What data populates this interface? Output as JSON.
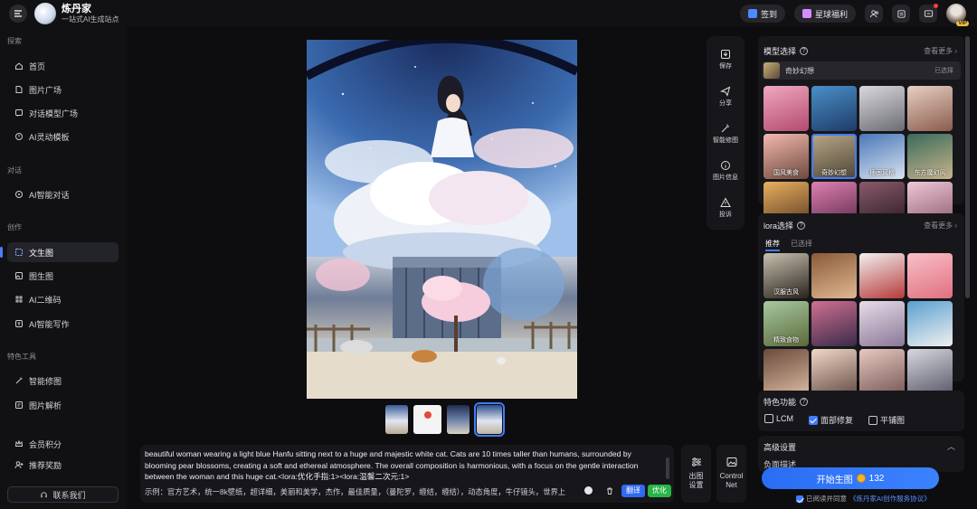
{
  "brand": {
    "name": "炼丹家",
    "slogan": "一站式AI生成站点"
  },
  "topbar": {
    "checkin": "签到",
    "benefits": "星球福利",
    "vip_badge": "VIP",
    "icons": [
      "user-group-icon",
      "exchange-icon",
      "message-icon",
      "avatar"
    ]
  },
  "sidebar": {
    "sections": [
      {
        "title": "探索",
        "items": [
          "首页",
          "图片广场",
          "对话模型广场",
          "AI灵动模板"
        ]
      },
      {
        "title": "对话",
        "items": [
          "AI智能对话"
        ]
      },
      {
        "title": "创作",
        "items": [
          "文生图",
          "图生图",
          "AI二维码",
          "AI智能写作"
        ]
      },
      {
        "title": "特色工具",
        "items": [
          "智能修图",
          "图片解析"
        ]
      },
      {
        "title": "",
        "items": [
          "会员积分",
          "推荐奖励"
        ]
      }
    ],
    "active_item": "文生图",
    "contact": "联系我们"
  },
  "tools": [
    "保存",
    "分享",
    "智能修图",
    "图片信息",
    "投诉"
  ],
  "prompt": {
    "text": "beautiful woman wearing a light blue Hanfu sitting next to a huge and majestic white cat. Cats are 10 times taller than humans, surrounded by blooming pear blossoms, creating a soft and ethereal atmosphere. The overall composition is harmonious, with a focus on the gentle interaction between the woman and this huge cat.<lora:优化手指:1><lora:温馨二次元:1>",
    "example": "示例：官方艺术，统一8k壁纸，超详细，美丽和美学，杰作，最佳质量，（曼陀罗，缠结，缠结），动态角度，牛仔镜头，世界上",
    "translate": "翻译",
    "optimize": "优化",
    "output_settings": "出图设置",
    "controlnet": "Control Net"
  },
  "models": {
    "title": "模型选择",
    "more": "查看更多",
    "selected_name": "奇妙幻想",
    "selected_status": "已选择",
    "tiles": [
      "",
      "",
      "",
      "",
      "国风美食",
      "奇妙幻想",
      "插画风格",
      "东方魔幻风",
      "",
      "",
      "",
      ""
    ]
  },
  "lora": {
    "title": "lora选择",
    "more": "查看更多",
    "tab_recommend": "推荐",
    "tab_selected": "已选择",
    "tiles": [
      "汉服古风",
      "",
      "",
      "",
      "精致食物",
      "",
      "",
      "",
      "",
      "",
      "",
      ""
    ]
  },
  "features": {
    "title": "特色功能",
    "options": [
      {
        "label": "LCM",
        "checked": false
      },
      {
        "label": "面部修复",
        "checked": true
      },
      {
        "label": "平铺图",
        "checked": false
      }
    ]
  },
  "advanced": {
    "title": "高级设置",
    "desc_label": "负面描述"
  },
  "start": {
    "label": "开始生图",
    "cost": "132"
  },
  "agreement": {
    "prefix": "已阅读并同意",
    "link": "《炼丹家AI创作服务协议》"
  }
}
